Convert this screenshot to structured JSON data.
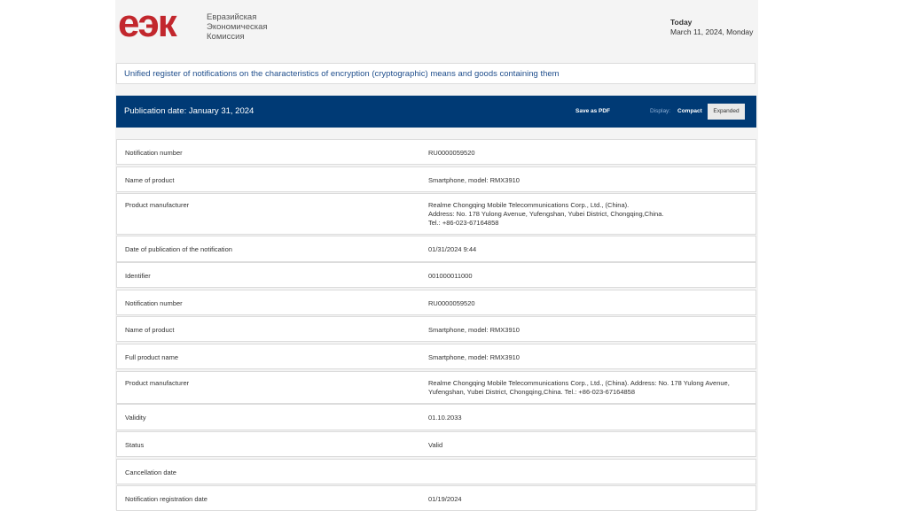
{
  "header": {
    "logo_mark": "еэк",
    "logo_lines": [
      "Евразийская",
      "Экономическая",
      "Комиссия"
    ],
    "today_label": "Today",
    "today_value": "March 11, 2024, Monday"
  },
  "register_title": "Unified register of notifications on the characteristics of encryption (cryptographic) means and goods containing them",
  "toolbar": {
    "publication": "Publication date: January 31, 2024",
    "save_pdf": "Save as PDF",
    "display_label": "Display:",
    "compact": "Compact",
    "expanded": "Expanded"
  },
  "colors": {
    "brand_red": "#c2272d",
    "bar_blue": "#003a75"
  },
  "rows": [
    {
      "key": "Notification number",
      "value": [
        "RU0000059520"
      ]
    },
    {
      "key": "Name of product",
      "value": [
        "Smartphone, model: RMX3910"
      ]
    },
    {
      "key": "Product manufacturer",
      "value": [
        "Realme Chongqing Mobile Telecommunications Corp., Ltd., (China).",
        "Address: No. 178 Yulong Avenue, Yufengshan, Yubei District, Chongqing,China.",
        "Tel.: +86-023-67164858"
      ]
    },
    {
      "key": "Date of publication of the notification",
      "value": [
        "01/31/2024 9:44"
      ]
    },
    {
      "key": "Identifier",
      "value": [
        "001000011000"
      ]
    },
    {
      "key": "Notification number",
      "value": [
        "RU0000059520"
      ]
    },
    {
      "key": "Name of product",
      "value": [
        "Smartphone, model: RMX3910"
      ]
    },
    {
      "key": "Full product name",
      "value": [
        "Smartphone, model: RMX3910"
      ]
    },
    {
      "key": "Product manufacturer",
      "value": [
        "Realme Chongqing Mobile Telecommunications Corp., Ltd., (China). Address: No. 178 Yulong Avenue,",
        "Yufengshan, Yubei District, Chongqing,China. Tel.: +86-023-67164858"
      ]
    },
    {
      "key": "Validity",
      "value": [
        "01.10.2033"
      ]
    },
    {
      "key": "Status",
      "value": [
        "Valid"
      ]
    },
    {
      "key": "Cancellation date",
      "value": [
        ""
      ]
    },
    {
      "key": "Notification registration date",
      "value": [
        "01/19/2024"
      ]
    }
  ]
}
